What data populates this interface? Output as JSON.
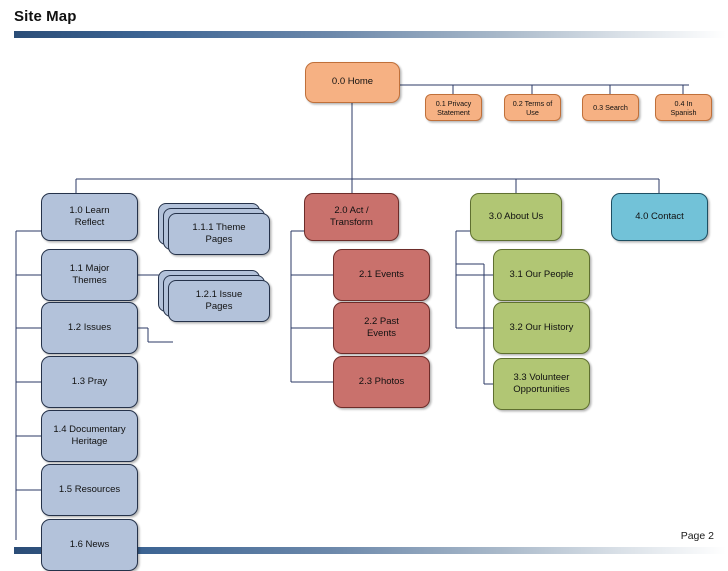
{
  "header": {
    "title": "Site Map"
  },
  "footer": {
    "page_label": "Page 2"
  },
  "theme": {
    "line_color": "#2b3a66",
    "orange": "#f6b183",
    "blue": "#b3c2da",
    "red": "#c9716c",
    "green": "#b1c674",
    "cyan": "#72c2d8",
    "rule_gradient_start": "#2b4d77",
    "rule_gradient_end": "#ffffff"
  },
  "chart_data": {
    "type": "diagram",
    "title": "Site Map",
    "diagram_kind": "site-map-tree",
    "nodes": [
      {
        "id": "0.0",
        "label": "0.0 Home",
        "color": "orange",
        "level": 0,
        "shape": "rounded"
      },
      {
        "id": "0.1",
        "label": "0.1 Privacy Statement",
        "color": "orange",
        "level": 1,
        "shape": "rounded"
      },
      {
        "id": "0.2",
        "label": "0.2 Terms of Use",
        "color": "orange",
        "level": 1,
        "shape": "rounded"
      },
      {
        "id": "0.3",
        "label": "0.3 Search",
        "color": "orange",
        "level": 1,
        "shape": "rounded"
      },
      {
        "id": "0.4",
        "label": "0.4 In Spanish",
        "color": "orange",
        "level": 1,
        "shape": "rounded"
      },
      {
        "id": "1.0",
        "label": "1.0 Learn Reflect",
        "color": "blue",
        "level": 1,
        "shape": "rounded"
      },
      {
        "id": "1.1",
        "label": "1.1 Major Themes",
        "color": "blue",
        "level": 2,
        "shape": "rounded"
      },
      {
        "id": "1.1.1",
        "label": "1.1.1 Theme Pages",
        "color": "blue",
        "level": 3,
        "shape": "stack"
      },
      {
        "id": "1.2",
        "label": "1.2 Issues",
        "color": "blue",
        "level": 2,
        "shape": "rounded"
      },
      {
        "id": "1.2.1",
        "label": "1.2.1 Issue Pages",
        "color": "blue",
        "level": 3,
        "shape": "stack"
      },
      {
        "id": "1.3",
        "label": "1.3 Pray",
        "color": "blue",
        "level": 2,
        "shape": "rounded"
      },
      {
        "id": "1.4",
        "label": "1.4 Documentary Heritage",
        "color": "blue",
        "level": 2,
        "shape": "rounded"
      },
      {
        "id": "1.5",
        "label": "1.5 Resources",
        "color": "blue",
        "level": 2,
        "shape": "rounded"
      },
      {
        "id": "1.6",
        "label": "1.6 News",
        "color": "blue",
        "level": 2,
        "shape": "rounded"
      },
      {
        "id": "2.0",
        "label": "2.0 Act / Transform",
        "color": "red",
        "level": 1,
        "shape": "rounded"
      },
      {
        "id": "2.1",
        "label": "2.1 Events",
        "color": "red",
        "level": 2,
        "shape": "rounded"
      },
      {
        "id": "2.2",
        "label": "2.2 Past Events",
        "color": "red",
        "level": 2,
        "shape": "rounded"
      },
      {
        "id": "2.3",
        "label": "2.3 Photos",
        "color": "red",
        "level": 2,
        "shape": "rounded"
      },
      {
        "id": "3.0",
        "label": "3.0 About Us",
        "color": "green",
        "level": 1,
        "shape": "rounded"
      },
      {
        "id": "3.1",
        "label": "3.1 Our People",
        "color": "green",
        "level": 2,
        "shape": "rounded"
      },
      {
        "id": "3.2",
        "label": "3.2 Our History",
        "color": "green",
        "level": 2,
        "shape": "rounded"
      },
      {
        "id": "3.3",
        "label": "3.3 Volunteer Opportunities",
        "color": "green",
        "level": 2,
        "shape": "rounded"
      },
      {
        "id": "4.0",
        "label": "4.0 Contact",
        "color": "cyan",
        "level": 1,
        "shape": "rounded"
      }
    ],
    "edges": [
      [
        "0.0",
        "0.1"
      ],
      [
        "0.0",
        "0.2"
      ],
      [
        "0.0",
        "0.3"
      ],
      [
        "0.0",
        "0.4"
      ],
      [
        "0.0",
        "1.0"
      ],
      [
        "0.0",
        "2.0"
      ],
      [
        "0.0",
        "3.0"
      ],
      [
        "0.0",
        "4.0"
      ],
      [
        "1.0",
        "1.1"
      ],
      [
        "1.0",
        "1.2"
      ],
      [
        "1.0",
        "1.3"
      ],
      [
        "1.0",
        "1.4"
      ],
      [
        "1.0",
        "1.5"
      ],
      [
        "1.0",
        "1.6"
      ],
      [
        "1.1",
        "1.1.1"
      ],
      [
        "1.2",
        "1.2.1"
      ],
      [
        "2.0",
        "2.1"
      ],
      [
        "2.0",
        "2.2"
      ],
      [
        "2.0",
        "2.3"
      ],
      [
        "3.0",
        "3.1"
      ],
      [
        "3.0",
        "3.2"
      ],
      [
        "3.0",
        "3.3"
      ]
    ]
  },
  "nodes": {
    "home": {
      "line1": "0.0 Home"
    },
    "privacy": {
      "line1": "0.1 Privacy",
      "line2": "Statement"
    },
    "terms": {
      "line1": "0.2 Terms of",
      "line2": "Use"
    },
    "search": {
      "line1": "0.3 Search"
    },
    "spanish": {
      "line1": "0.4 In",
      "line2": "Spanish"
    },
    "learn_reflect": {
      "line1": "1.0 Learn",
      "line2": "Reflect"
    },
    "major_themes": {
      "line1": "1.1 Major",
      "line2": "Themes"
    },
    "theme_pages": {
      "line1": "1.1.1 Theme",
      "line2": "Pages"
    },
    "issues": {
      "line1": "1.2 Issues"
    },
    "issue_pages": {
      "line1": "1.2.1 Issue",
      "line2": "Pages"
    },
    "pray": {
      "line1": "1.3 Pray"
    },
    "documentary": {
      "line1": "1.4 Documentary",
      "line2": "Heritage"
    },
    "resources": {
      "line1": "1.5 Resources"
    },
    "news": {
      "line1": "1.6 News"
    },
    "act_transform": {
      "line1": "2.0 Act /",
      "line2": "Transform"
    },
    "events": {
      "line1": "2.1 Events"
    },
    "past_events": {
      "line1": "2.2 Past",
      "line2": "Events"
    },
    "photos": {
      "line1": "2.3 Photos"
    },
    "about_us": {
      "line1": "3.0 About Us"
    },
    "our_people": {
      "line1": "3.1 Our People"
    },
    "our_history": {
      "line1": "3.2 Our History"
    },
    "volunteer": {
      "line1": "3.3 Volunteer",
      "line2": "Opportunities"
    },
    "contact": {
      "line1": "4.0 Contact"
    }
  }
}
